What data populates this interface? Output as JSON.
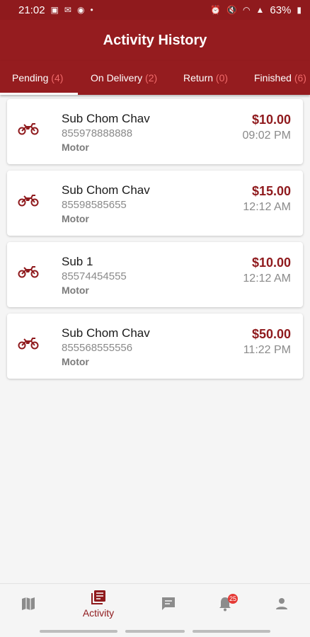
{
  "status_bar": {
    "time": "21:02",
    "battery": "63%"
  },
  "app_bar": {
    "title": "Activity History"
  },
  "tabs": [
    {
      "label": "Pending",
      "count": "(4)"
    },
    {
      "label": "On Delivery",
      "count": "(2)"
    },
    {
      "label": "Return",
      "count": "(0)"
    },
    {
      "label": "Finished",
      "count": "(6)"
    }
  ],
  "orders": [
    {
      "name": "Sub Chom Chav",
      "phone": "855978888888",
      "vehicle": "Motor",
      "price": "$10.00",
      "time": "09:02 PM"
    },
    {
      "name": "Sub Chom Chav",
      "phone": "85598585655",
      "vehicle": "Motor",
      "price": "$15.00",
      "time": "12:12 AM"
    },
    {
      "name": "Sub 1",
      "phone": "85574454555",
      "vehicle": "Motor",
      "price": "$10.00",
      "time": "12:12 AM"
    },
    {
      "name": "Sub Chom Chav",
      "phone": "855568555556",
      "vehicle": "Motor",
      "price": "$50.00",
      "time": "11:22 PM"
    }
  ],
  "bottom_nav": {
    "items": [
      {
        "icon": "map-icon"
      },
      {
        "icon": "activity-icon",
        "label": "Activity"
      },
      {
        "icon": "chat-icon"
      },
      {
        "icon": "bell-icon",
        "badge": "25"
      },
      {
        "icon": "person-icon"
      }
    ]
  },
  "colors": {
    "primary": "#951c1f",
    "accent": "#8f1a1d",
    "tab_count": "#f06a6a"
  }
}
